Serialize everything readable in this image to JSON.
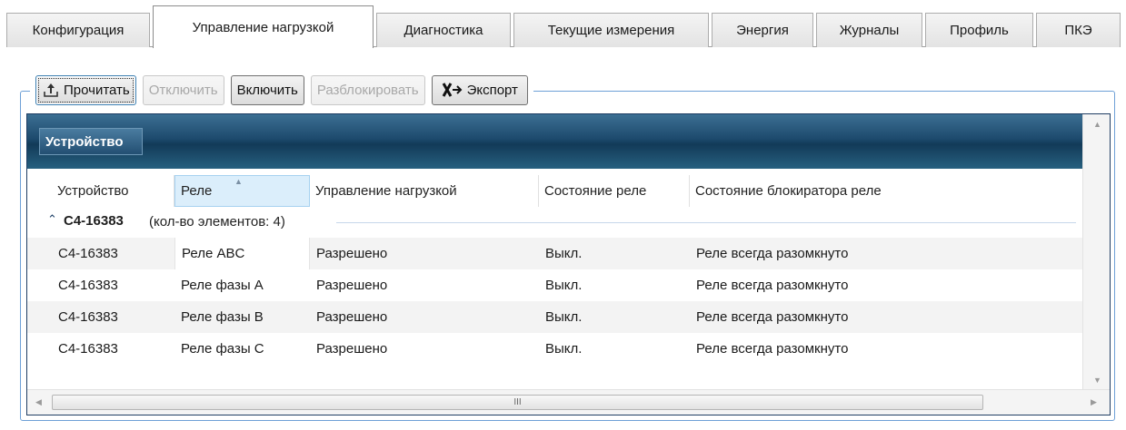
{
  "tabs": [
    {
      "label": "Конфигурация",
      "active": false
    },
    {
      "label": "Управление нагрузкой",
      "active": true
    },
    {
      "label": "Диагностика",
      "active": false
    },
    {
      "label": "Текущие измерения",
      "active": false
    },
    {
      "label": "Энергия",
      "active": false
    },
    {
      "label": "Журналы",
      "active": false
    },
    {
      "label": "Профиль",
      "active": false
    },
    {
      "label": "ПКЭ",
      "active": false
    }
  ],
  "toolbar": {
    "read_label": "Прочитать",
    "disable_label": "Отключить",
    "enable_label": "Включить",
    "unblock_label": "Разблокировать",
    "export_label": "Экспорт"
  },
  "grid": {
    "group_panel_chip": "Устройство",
    "columns": [
      "Устройство",
      "Реле",
      "Управление нагрузкой",
      "Состояние реле",
      "Состояние блокиратора реле"
    ],
    "sorted_column": "Реле",
    "group": {
      "key": "С4-16383",
      "count_text": "(кол-во элементов: 4)"
    },
    "rows": [
      [
        "С4-16383",
        "Реле ABC",
        "Разрешено",
        "Выкл.",
        "Реле всегда разомкнуто"
      ],
      [
        "С4-16383",
        "Реле фазы А",
        "Разрешено",
        "Выкл.",
        "Реле всегда разомкнуто"
      ],
      [
        "С4-16383",
        "Реле фазы В",
        "Разрешено",
        "Выкл.",
        "Реле всегда разомкнуто"
      ],
      [
        "С4-16383",
        "Реле фазы С",
        "Разрешено",
        "Выкл.",
        "Реле всегда разомкнуто"
      ]
    ],
    "hscroll_grip": "III"
  },
  "icons": {
    "read": "upload-icon",
    "export": "export-excel-icon",
    "expander": "collapse-caret-icon"
  },
  "colors": {
    "group_panel": "#1d4a6d",
    "frame_border": "#6ea0d6",
    "sorted_header": "#dbeefb"
  }
}
